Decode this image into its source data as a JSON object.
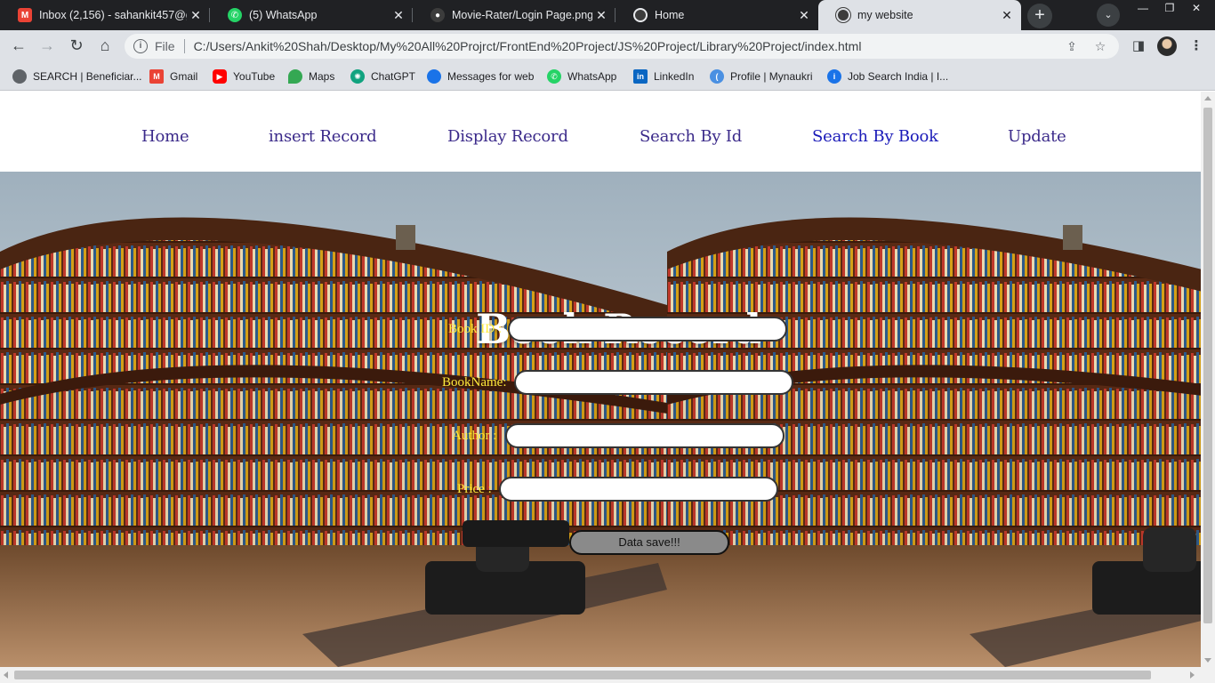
{
  "browser": {
    "tabs": [
      {
        "title": "Inbox (2,156) - sahankit457@g",
        "icon": "gmail-icon",
        "color": "#ea4335"
      },
      {
        "title": "(5) WhatsApp",
        "icon": "whatsapp-icon",
        "color": "#25d366"
      },
      {
        "title": "Movie-Rater/Login Page.png a",
        "icon": "github-icon",
        "color": "#3c3c3c"
      },
      {
        "title": "Home",
        "icon": "globe-icon",
        "color": "#3c3c3c"
      },
      {
        "title": "my website",
        "icon": "globe-icon",
        "color": "#3c3c3c"
      }
    ],
    "tab_close_glyph": "✕",
    "new_tab_glyph": "+",
    "omnibox": {
      "scheme_label": "File",
      "url": "C:/Users/Ankit%20Shah/Desktop/My%20All%20Projrct/FrontEnd%20Project/JS%20Project/Library%20Project/index.html"
    },
    "bookmarks": [
      {
        "label": "SEARCH | Beneficiar...",
        "icon": "globe-icon",
        "color": "#3c4043"
      },
      {
        "label": "Gmail",
        "icon": "gmail-icon",
        "color": "#ea4335"
      },
      {
        "label": "YouTube",
        "icon": "youtube-icon",
        "color": "#ff0000"
      },
      {
        "label": "Maps",
        "icon": "maps-icon",
        "color": "#34a853"
      },
      {
        "label": "ChatGPT",
        "icon": "chatgpt-icon",
        "color": "#10a37f"
      },
      {
        "label": "Messages for web",
        "icon": "messages-icon",
        "color": "#1a73e8"
      },
      {
        "label": "WhatsApp",
        "icon": "whatsapp-icon",
        "color": "#25d366"
      },
      {
        "label": "LinkedIn",
        "icon": "linkedin-icon",
        "color": "#0a66c2"
      },
      {
        "label": "Profile | Mynaukri",
        "icon": "naukri-icon",
        "color": "#4a90e2"
      },
      {
        "label": "Job Search India | I...",
        "icon": "info-icon",
        "color": "#1a73e8"
      }
    ]
  },
  "site": {
    "nav": [
      {
        "label": "Home"
      },
      {
        "label": "insert Record"
      },
      {
        "label": "Display Record"
      },
      {
        "label": "Search By Id"
      },
      {
        "label": "Search By Book"
      },
      {
        "label": "Update"
      }
    ],
    "heading": "Book Record",
    "form": {
      "fields": [
        {
          "label": "Book ID :",
          "value": ""
        },
        {
          "label": "BookName:",
          "value": ""
        },
        {
          "label": "Author :",
          "value": ""
        },
        {
          "label": "Price :",
          "value": ""
        }
      ],
      "submit_label": "Data save!!!"
    },
    "colors": {
      "nav_link": "#3b2a8a",
      "nav_link_visited": "#1a1ab8",
      "form_label": "#ffeb3b",
      "heading": "#ffffff"
    }
  }
}
